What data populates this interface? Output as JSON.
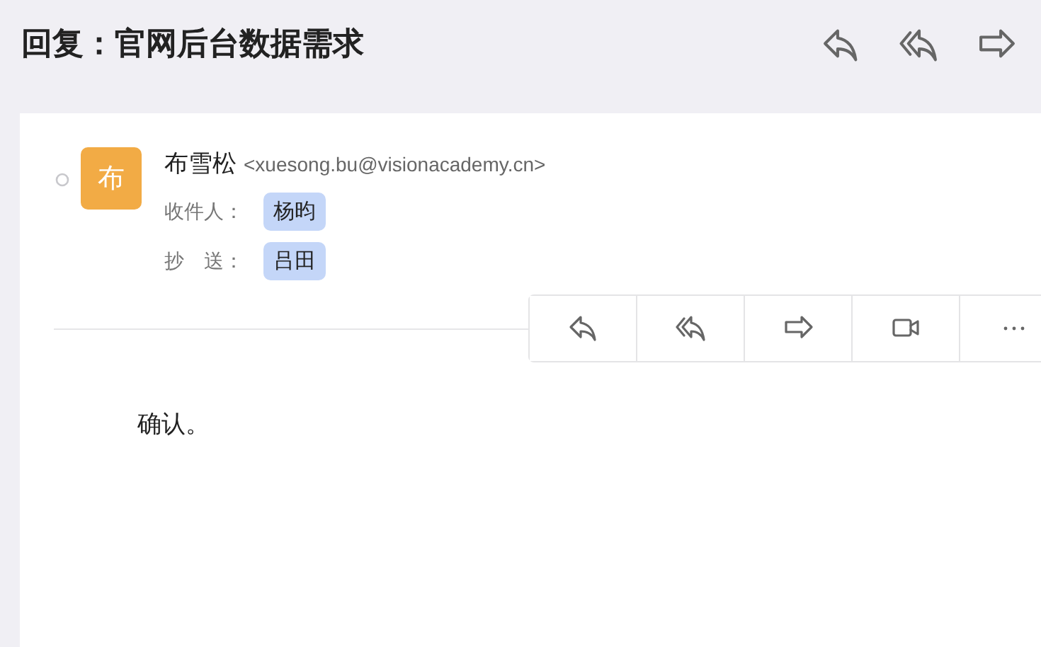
{
  "header": {
    "title": "回复：官网后台数据需求",
    "actions": [
      {
        "kind": "reply"
      },
      {
        "kind": "reply-all"
      },
      {
        "kind": "forward"
      }
    ]
  },
  "message": {
    "avatar": "布",
    "sender": "布雪松",
    "email": "<xuesong.bu@visionacademy.cn>",
    "recipients": [
      {
        "label": "收件人：",
        "names": [
          "杨昀"
        ]
      },
      {
        "label": "抄　送：",
        "names": [
          "吕田"
        ]
      }
    ],
    "toolbar": [
      {
        "kind": "reply"
      },
      {
        "kind": "reply-all"
      },
      {
        "kind": "forward"
      },
      {
        "kind": "video"
      },
      {
        "kind": "more"
      }
    ],
    "body": "确认。"
  }
}
